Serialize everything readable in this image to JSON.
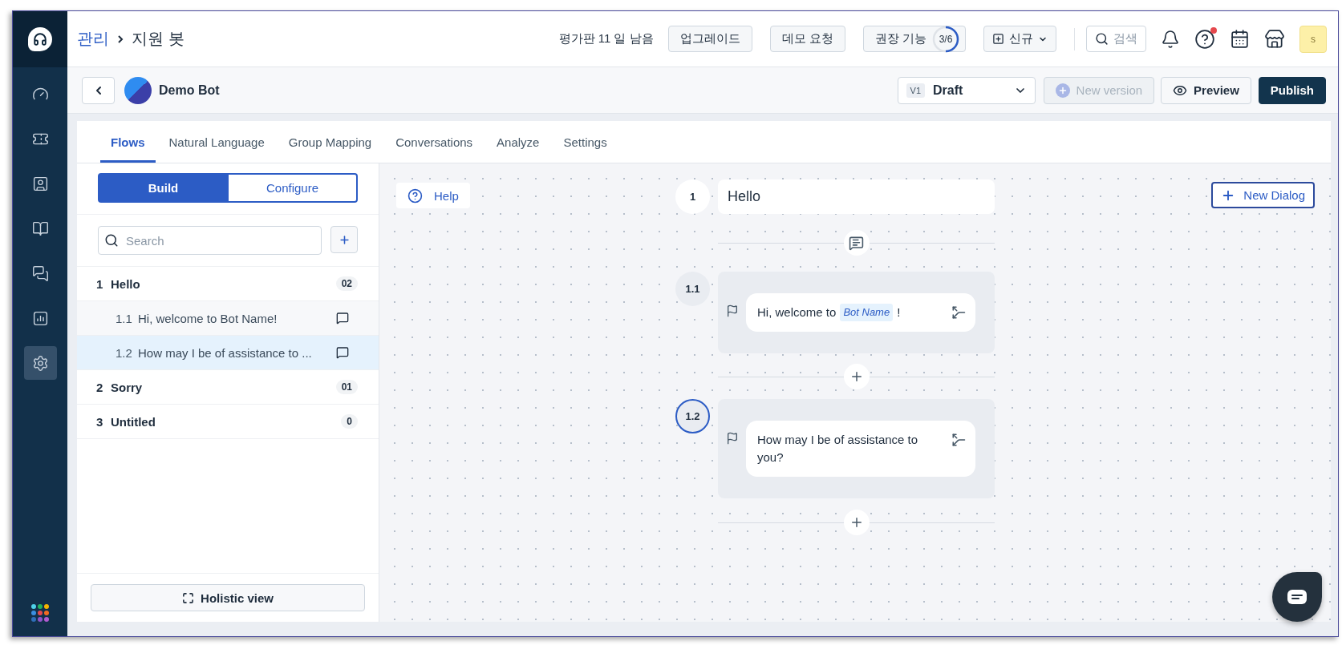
{
  "sidebar": {
    "items": [
      {
        "kind": "dashboard",
        "selected": false
      },
      {
        "kind": "tickets",
        "selected": false
      },
      {
        "kind": "contacts",
        "selected": false
      },
      {
        "kind": "knowledge",
        "selected": false
      },
      {
        "kind": "conversations",
        "selected": false
      },
      {
        "kind": "analytics",
        "selected": false
      },
      {
        "kind": "settings",
        "selected": true
      }
    ]
  },
  "topbar": {
    "breadcrumb": [
      {
        "label": "관리",
        "kind": "link"
      },
      {
        "label": "지원 봇",
        "kind": "current"
      }
    ],
    "trial": "평가판 11 일 남음",
    "buttons": [
      {
        "label": "업그레이드"
      },
      {
        "label": "데모 요청"
      }
    ],
    "recommended": {
      "label": "권장 기능",
      "progress": "3/6",
      "level": 0.5
    },
    "new_menu": {
      "label": "신규"
    },
    "search": {
      "placeholder": "검색"
    },
    "help": {
      "notification": true
    },
    "avatar": "s"
  },
  "bot_header": {
    "name": "Demo Bot",
    "version": {
      "tag": "V1",
      "label": "Draft"
    },
    "new_version": {
      "label": "New version",
      "disabled": true
    },
    "preview": "Preview",
    "publish": "Publish"
  },
  "tabs": [
    {
      "label": "Flows",
      "selected": true
    },
    {
      "label": "Natural Language",
      "selected": false
    },
    {
      "label": "Group Mapping",
      "selected": false
    },
    {
      "label": "Conversations",
      "selected": false
    },
    {
      "label": "Analyze",
      "selected": false
    },
    {
      "label": "Settings",
      "selected": false
    }
  ],
  "flows_panel": {
    "modes": [
      {
        "label": "Build",
        "selected": true
      },
      {
        "label": "Configure",
        "selected": false
      }
    ],
    "search": {
      "placeholder": "Search"
    },
    "flows": [
      {
        "number": "1",
        "title": "Hello",
        "count": "02",
        "children": [
          {
            "number": "1.1",
            "title": "Hi, welcome to Bot Name!",
            "selected": false
          },
          {
            "number": "1.2",
            "title": "How may I be of assistance to ...",
            "selected": true
          }
        ]
      },
      {
        "number": "2",
        "title": "Sorry",
        "count": "01"
      },
      {
        "number": "3",
        "title": "Untitled",
        "count": "0"
      }
    ],
    "holistic": "Holistic view"
  },
  "canvas": {
    "help": "Help",
    "new_dialog": "New Dialog",
    "flow": {
      "number": "1",
      "title": "Hello"
    },
    "messages": [
      {
        "number": "1.1",
        "selected": false,
        "parts": [
          {
            "kind": "text",
            "text": "Hi, welcome to"
          },
          {
            "kind": "variable",
            "text": "Bot Name"
          },
          {
            "kind": "text",
            "text": "!"
          }
        ]
      },
      {
        "number": "1.2",
        "selected": true,
        "parts": [
          {
            "kind": "text",
            "text": "How may I be of assistance to you?"
          }
        ]
      }
    ]
  }
}
